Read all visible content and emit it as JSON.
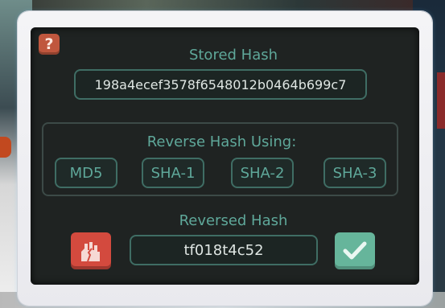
{
  "help": {
    "label": "?"
  },
  "stored_hash": {
    "label": "Stored Hash",
    "value": "198a4ecef3578f6548012b0464b699c7"
  },
  "reverse": {
    "label": "Reverse Hash Using:",
    "algorithms": [
      "MD5",
      "SHA-1",
      "SHA-2",
      "SHA-3"
    ]
  },
  "reversed_hash": {
    "label": "Reversed Hash",
    "value": "tf018t4c52"
  },
  "colors": {
    "accent": "#5fa89a",
    "cancel": "#d34a3e",
    "confirm": "#66b59b",
    "help": "#c0573e"
  },
  "icons": {
    "cancel": "broken-glove-icon",
    "confirm": "checkmark-icon"
  }
}
